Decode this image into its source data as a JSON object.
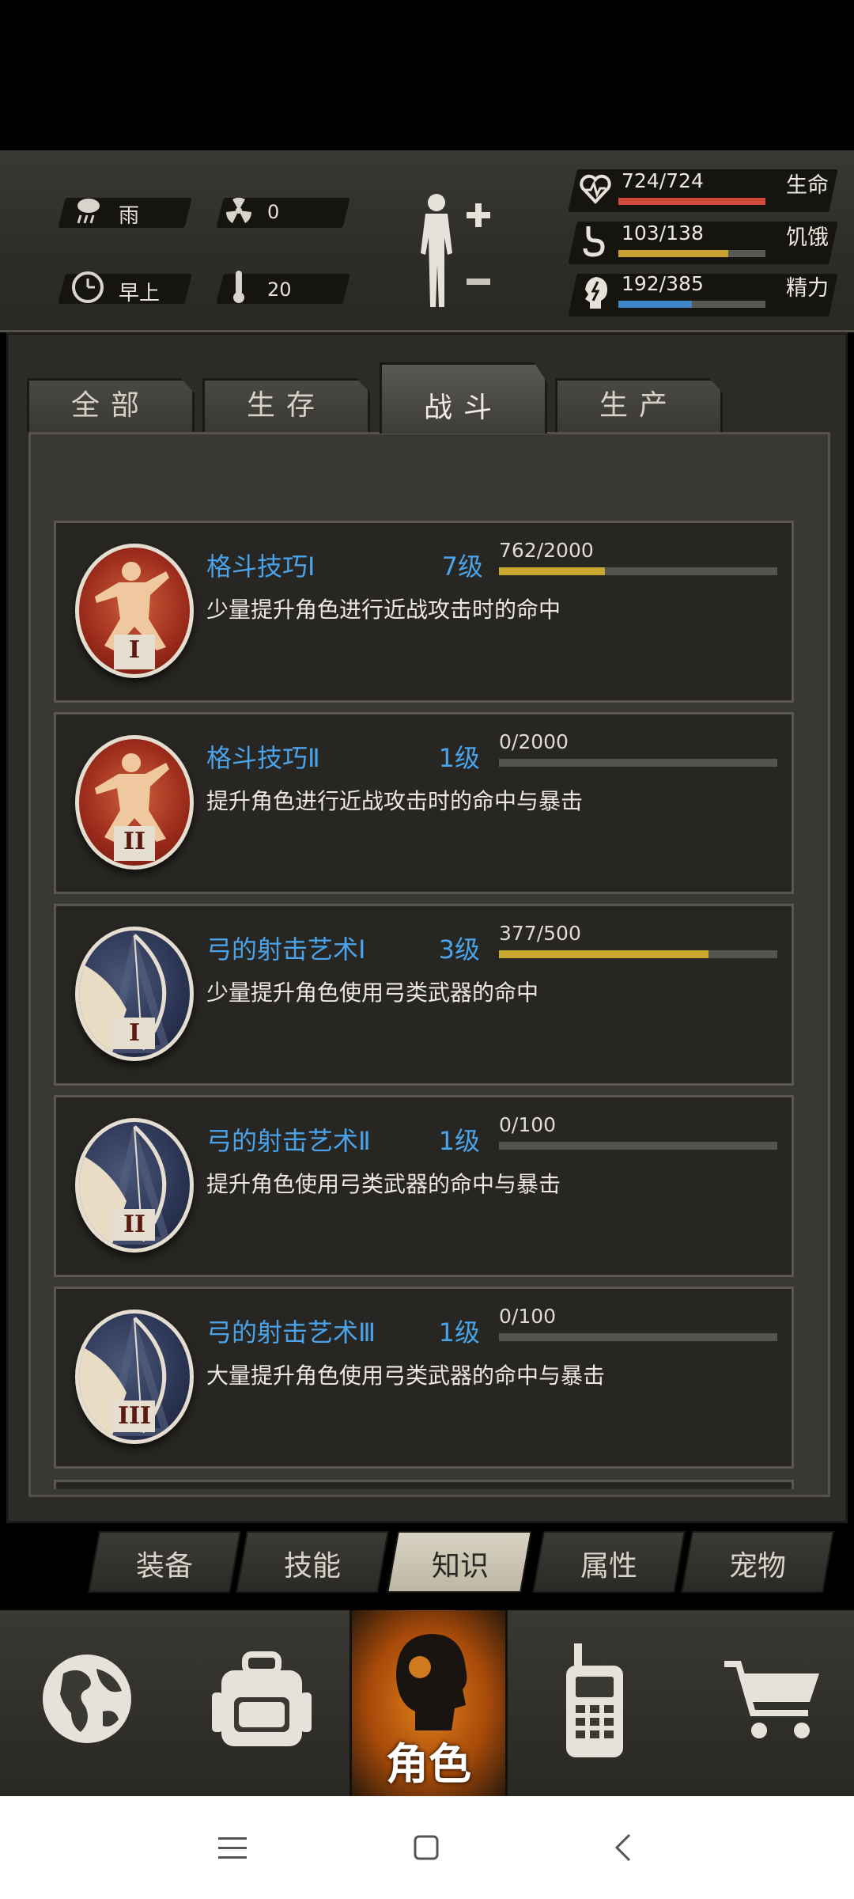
{
  "status": {
    "weather": "雨",
    "radiation": "0",
    "time_of_day": "早上",
    "temperature": "20",
    "bars": [
      {
        "icon": "heart-icon",
        "value": "724/724",
        "label": "生命",
        "fraction": 1.0,
        "color": "#d04a3a"
      },
      {
        "icon": "stomach-icon",
        "value": "103/138",
        "label": "饥饿",
        "fraction": 0.746,
        "color": "#c8a030"
      },
      {
        "icon": "brain-icon",
        "value": "192/385",
        "label": "精力",
        "fraction": 0.499,
        "color": "#3e84c8"
      }
    ]
  },
  "tabs": [
    {
      "label": "全部",
      "active": false
    },
    {
      "label": "生存",
      "active": false
    },
    {
      "label": "战斗",
      "active": true
    },
    {
      "label": "生产",
      "active": false
    }
  ],
  "skills": [
    {
      "title": "格斗技巧Ⅰ",
      "level": "7级",
      "progress": "762/2000",
      "fraction": 0.381,
      "desc": "少量提升角色进行近战攻击时的命中",
      "icon": "fighter-icon",
      "numeral": "I"
    },
    {
      "title": "格斗技巧Ⅱ",
      "level": "1级",
      "progress": "0/2000",
      "fraction": 0.0,
      "desc": "提升角色进行近战攻击时的命中与暴击",
      "icon": "fighter-icon",
      "numeral": "II"
    },
    {
      "title": "弓的射击艺术Ⅰ",
      "level": "3级",
      "progress": "377/500",
      "fraction": 0.754,
      "desc": "少量提升角色使用弓类武器的命中",
      "icon": "archer-icon",
      "numeral": "I"
    },
    {
      "title": "弓的射击艺术Ⅱ",
      "level": "1级",
      "progress": "0/100",
      "fraction": 0.0,
      "desc": "提升角色使用弓类武器的命中与暴击",
      "icon": "archer-icon",
      "numeral": "II"
    },
    {
      "title": "弓的射击艺术Ⅲ",
      "level": "1级",
      "progress": "0/100",
      "fraction": 0.0,
      "desc": "大量提升角色使用弓类武器的命中与暴击",
      "icon": "archer-icon",
      "numeral": "III"
    }
  ],
  "subtabs": [
    {
      "label": "装备",
      "active": false
    },
    {
      "label": "技能",
      "active": false
    },
    {
      "label": "知识",
      "active": true
    },
    {
      "label": "属性",
      "active": false
    },
    {
      "label": "宠物",
      "active": false
    }
  ],
  "bottom_nav": {
    "active_label": "角色",
    "items": [
      "globe-icon",
      "backpack-icon",
      "character-icon",
      "radio-icon",
      "cart-icon"
    ]
  }
}
